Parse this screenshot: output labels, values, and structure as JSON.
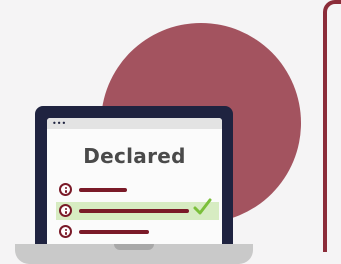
{
  "colors": {
    "background": "#f5f4f5",
    "circle": "#a3535f",
    "frame": "#8b2c39",
    "laptop": "#1f2340",
    "screen": "#fbfbfb",
    "accent_bar": "#7a1a28",
    "highlight": "#d7ecc2",
    "check": "#7bbf3a"
  },
  "screen": {
    "dots": "•••",
    "title": "Declared"
  },
  "rows": [
    {
      "icon": "person-info-icon",
      "selected": false
    },
    {
      "icon": "person-info-icon",
      "selected": true
    },
    {
      "icon": "person-info-icon",
      "selected": false
    }
  ],
  "icons": {
    "check": "checkmark-icon"
  }
}
